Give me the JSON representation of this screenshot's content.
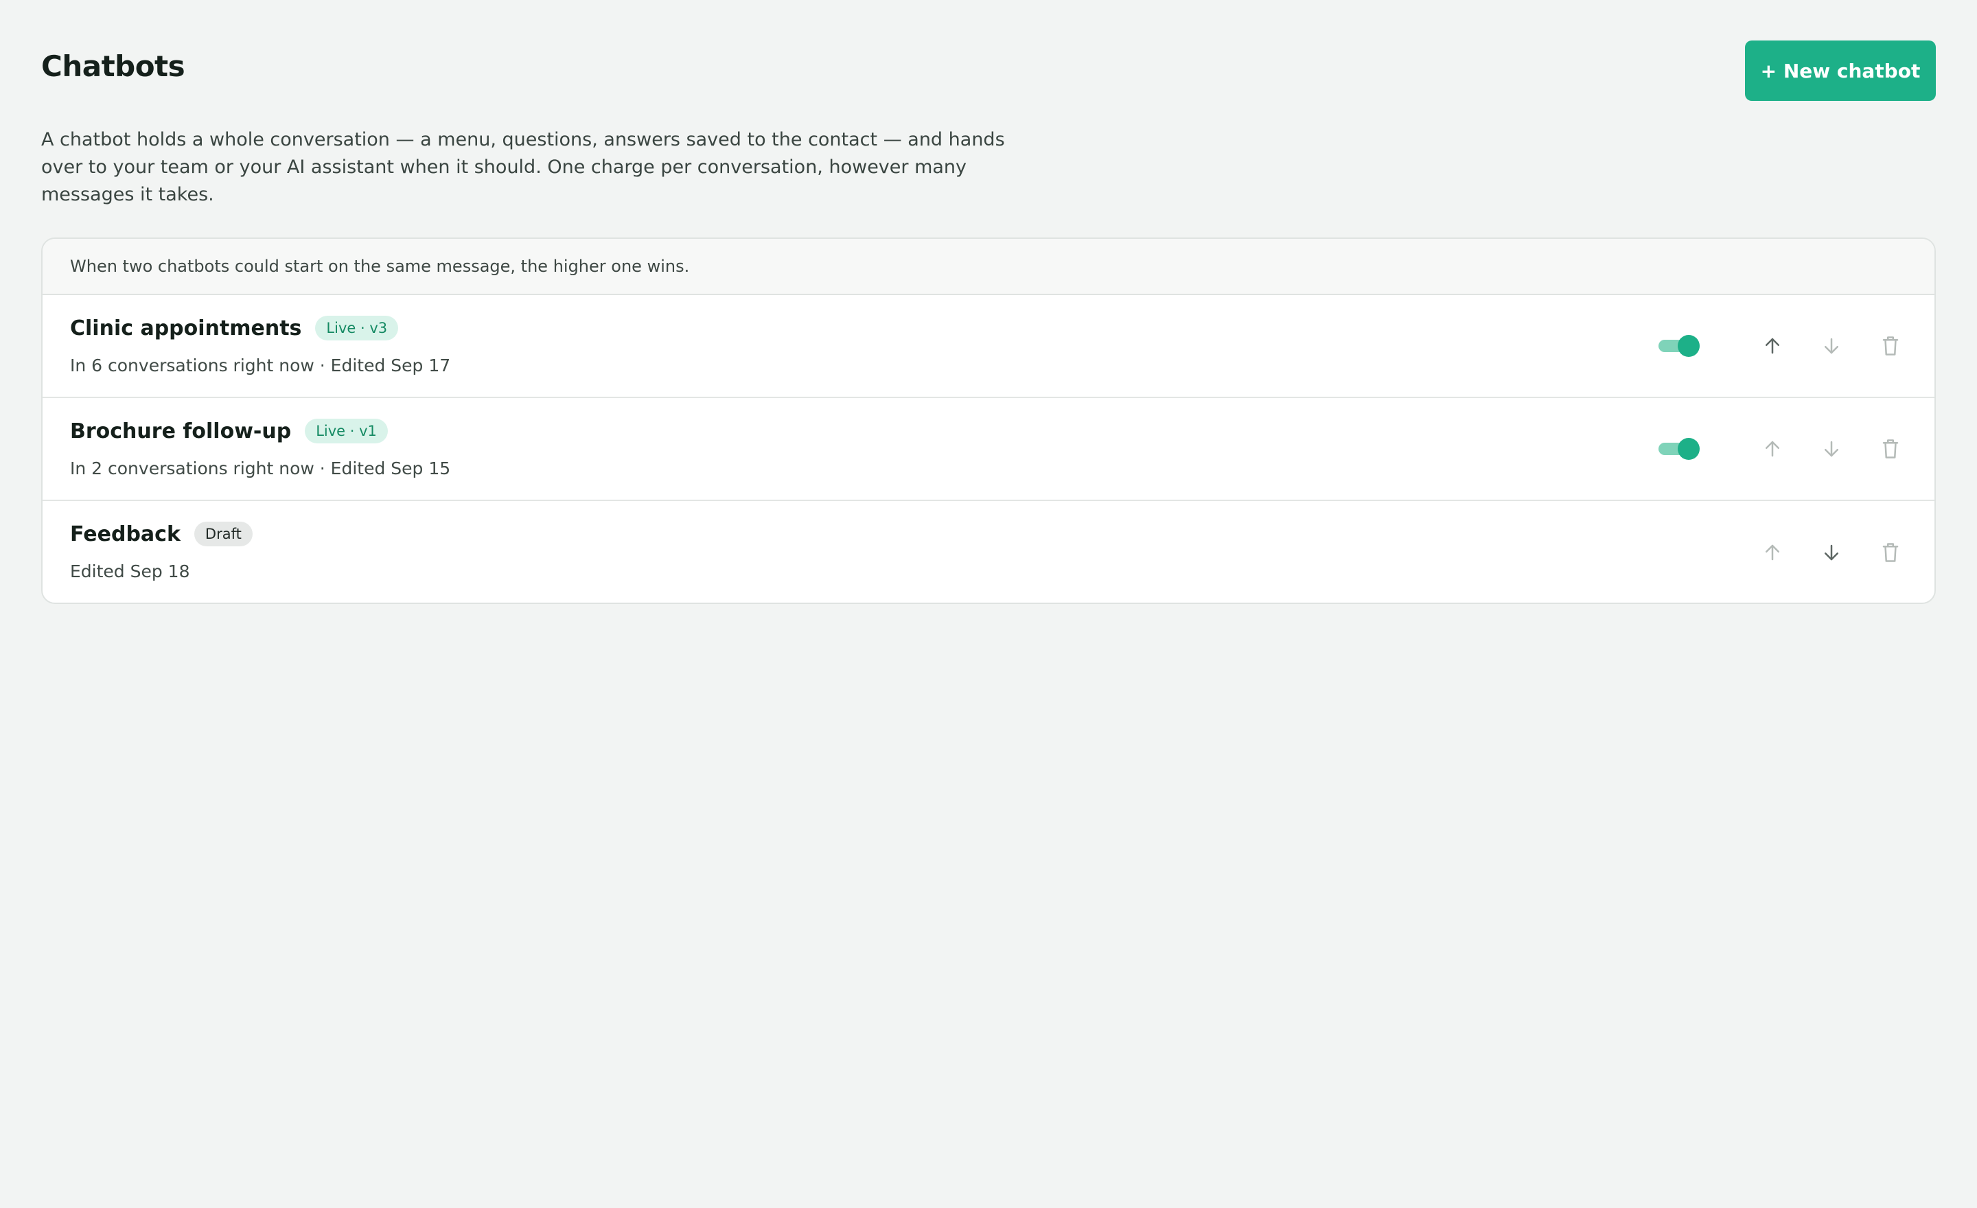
{
  "page": {
    "title": "Chatbots",
    "new_button_label": "+ New chatbot",
    "intro": "A chatbot holds a whole conversation — a menu, questions, answers saved to the contact — and hands over to your team or your AI assistant when it should. One charge per conversation, however many messages it takes."
  },
  "list": {
    "note": "When two chatbots could start on the same message, the higher one wins.",
    "items": [
      {
        "name": "Clinic appointments",
        "badge": "Live · v3",
        "status": "live",
        "meta": "In 6 conversations right now · Edited Sep 17",
        "enabled": true
      },
      {
        "name": "Brochure follow-up",
        "badge": "Live · v1",
        "status": "live",
        "meta": "In 2 conversations right now · Edited Sep 15",
        "enabled": true
      },
      {
        "name": "Feedback",
        "badge": "Draft",
        "status": "draft",
        "meta": "Edited Sep 18",
        "enabled": false
      }
    ]
  },
  "icons": {
    "move_up": "arrow-up-icon",
    "move_down": "arrow-down-icon",
    "delete": "trash-icon"
  },
  "colors": {
    "accent": "#1db088",
    "toggle_track": "#7fd3b9",
    "live_badge_bg": "#d9f3ea",
    "live_badge_text": "#158a63",
    "draft_badge_bg": "#e6e8e7",
    "icon_active": "#5d6663",
    "icon_disabled": "#b4bab7"
  }
}
